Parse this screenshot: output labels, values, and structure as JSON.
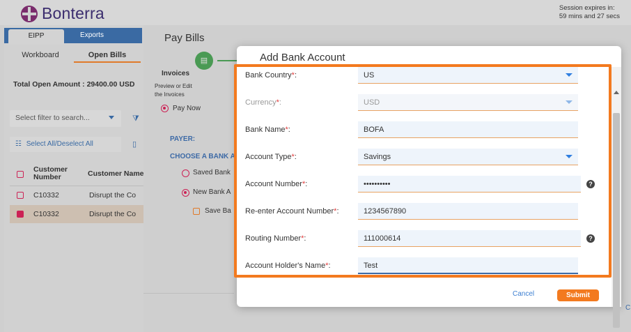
{
  "header": {
    "brand": "Bonterra",
    "session_line1": "Session expires in:",
    "session_line2": "59 mins and 27 secs"
  },
  "left": {
    "tabs": [
      "EIPP",
      "Exports"
    ],
    "subtabs": [
      "Workboard",
      "Open Bills"
    ],
    "total": "Total Open Amount : 29400.00  USD",
    "filter_placeholder": "Select filter to search...",
    "select_all": "Select All/Deselect All",
    "columns": [
      "Customer Number",
      "Customer Name"
    ],
    "rows": [
      {
        "number": "C10332",
        "name": "Disrupt the Co",
        "checked": false
      },
      {
        "number": "C10332",
        "name": "Disrupt the Co",
        "checked": true
      }
    ]
  },
  "main": {
    "title": "Pay Bills",
    "invoices_title": "Invoices",
    "invoices_sub1": "Preview or Edit",
    "invoices_sub2": "the Invoices",
    "pay_now": "Pay Now",
    "payer": "PAYER:",
    "choose_bank": "CHOOSE A BANK A",
    "saved_bank": "Saved Bank",
    "new_bank": "New Bank A",
    "save_bank": "Save Ba",
    "right_partial": "C"
  },
  "modal": {
    "title": "Add Bank Account",
    "fields": [
      {
        "label": "Bank Country",
        "value": "US"
      },
      {
        "label": "Currency",
        "value": "USD"
      },
      {
        "label": "Bank Name",
        "value": "BOFA"
      },
      {
        "label": "Account Type",
        "value": "Savings"
      },
      {
        "label": "Account Number",
        "value": "••••••••••"
      },
      {
        "label": "Re-enter Account Number",
        "value": "1234567890"
      },
      {
        "label": "Routing Number",
        "value": "111000614"
      },
      {
        "label": "Account Holder's Name",
        "value": "Test"
      }
    ],
    "required_mark": "*",
    "field_suffix": ":",
    "help_glyph": "?",
    "cancel": "Cancel",
    "submit": "Submit",
    "highlight_color": "#f37a1f"
  }
}
